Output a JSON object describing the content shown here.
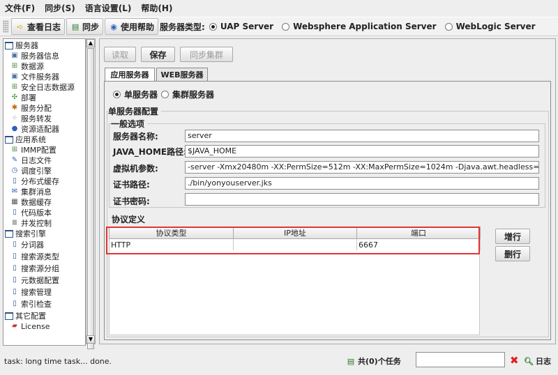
{
  "menubar": [
    "文件(F)",
    "同步(S)",
    "语言设置(L)",
    "帮助(H)"
  ],
  "toolbar": {
    "view_log": "查看日志",
    "sync": "同步",
    "help": "使用帮助",
    "server_type_label": "服务器类型:",
    "server_types": [
      "UAP Server",
      "Websphere Application Server",
      "WebLogic Server"
    ],
    "selected_server_type": "UAP Server"
  },
  "tree": {
    "groups": [
      {
        "label": "服务器",
        "items": [
          {
            "label": "服务器信息",
            "icon": "monitor-icon"
          },
          {
            "label": "数据源",
            "icon": "database-icon"
          },
          {
            "label": "文件服务器",
            "icon": "monitor-icon"
          },
          {
            "label": "安全日志数据源",
            "icon": "database-icon"
          },
          {
            "label": "部署",
            "icon": "deploy-icon"
          },
          {
            "label": "服务分配",
            "icon": "assign-icon"
          },
          {
            "label": "服务转发",
            "icon": "forward-icon"
          },
          {
            "label": "资源适配器",
            "icon": "dot-icon"
          }
        ]
      },
      {
        "label": "应用系统",
        "items": [
          {
            "label": "IMMP配置",
            "icon": "database-icon"
          },
          {
            "label": "日志文件",
            "icon": "log-icon"
          },
          {
            "label": "调度引擎",
            "icon": "clock-icon"
          },
          {
            "label": "分布式缓存",
            "icon": "page-icon"
          },
          {
            "label": "集群消息",
            "icon": "mail-icon"
          },
          {
            "label": "数据缓存",
            "icon": "grid-icon"
          },
          {
            "label": "代码版本",
            "icon": "page-icon"
          },
          {
            "label": "并发控制",
            "icon": "list-icon"
          }
        ]
      },
      {
        "label": "搜索引擎",
        "items": [
          {
            "label": "分词器",
            "icon": "page-icon"
          },
          {
            "label": "搜索源类型",
            "icon": "page-icon"
          },
          {
            "label": "搜索源分组",
            "icon": "page-icon"
          },
          {
            "label": "元数据配置",
            "icon": "page-icon"
          },
          {
            "label": "搜索管理",
            "icon": "page-icon"
          },
          {
            "label": "索引检查",
            "icon": "page-icon"
          }
        ]
      },
      {
        "label": "其它配置",
        "items": [
          {
            "label": "License",
            "icon": "license-icon"
          }
        ]
      }
    ]
  },
  "main": {
    "buttons": {
      "read": "读取",
      "save": "保存",
      "sync_cluster": "同步集群"
    },
    "tabs": [
      "应用服务器",
      "WEB服务器"
    ],
    "mode_options": [
      "单服务器",
      "集群服务器"
    ],
    "selected_mode": "单服务器",
    "section_title": "单服务器配置",
    "general_title": "一般选项",
    "fields": [
      {
        "label": "服务器名称:",
        "value": "server"
      },
      {
        "label": "JAVA_HOME路径:",
        "value": "$JAVA_HOME"
      },
      {
        "label": "虚拟机参数:",
        "value": "-server -Xmx20480m -XX:PermSize=512m -XX:MaxPermSize=1024m -Djava.awt.headless=true -Dfile.enco"
      },
      {
        "label": "证书路径:",
        "value": "./bin/yonyouserver.jks"
      },
      {
        "label": "证书密码:",
        "value": ""
      }
    ],
    "protocol_title": "协议定义",
    "table": {
      "columns": [
        "协议类型",
        "IP地址",
        "端口"
      ],
      "rows": [
        [
          "HTTP",
          "",
          "6667"
        ]
      ]
    },
    "add_row": "增行",
    "delete_row": "删行"
  },
  "statusbar": {
    "message": "task: long time task... done.",
    "tasks": "共(0)个任务",
    "log": "日志"
  }
}
